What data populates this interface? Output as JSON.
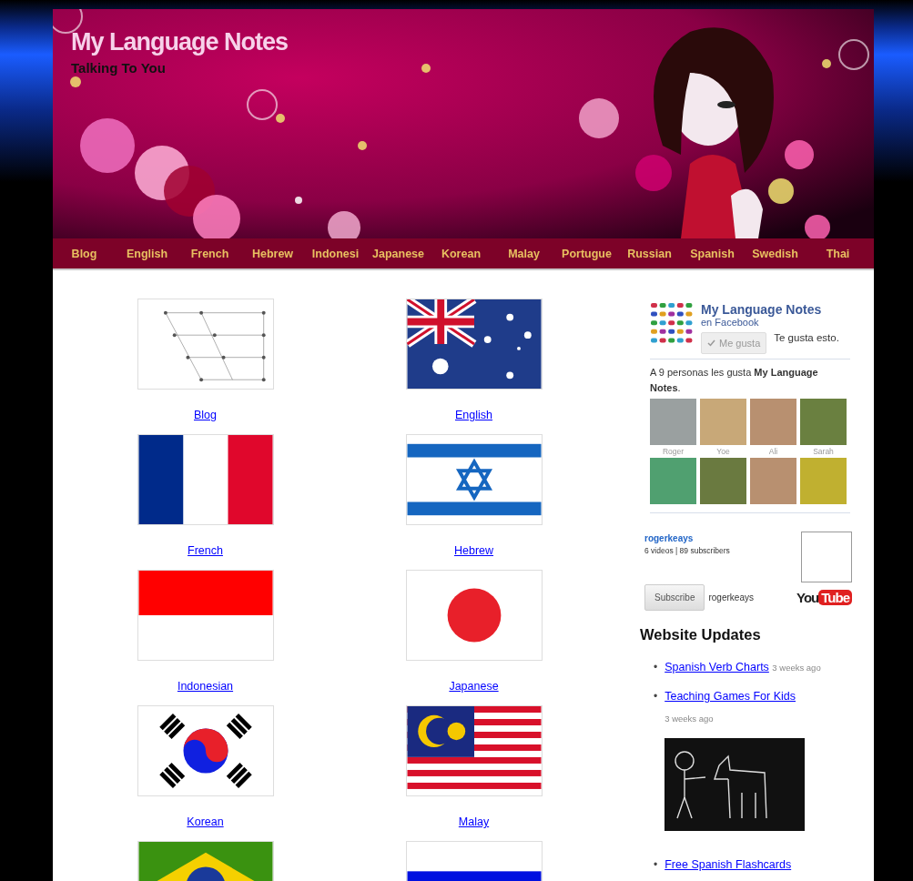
{
  "site": {
    "title": "My Language Notes",
    "tagline": "Talking To You"
  },
  "nav": [
    {
      "label": "Blog"
    },
    {
      "label": "English"
    },
    {
      "label": "French"
    },
    {
      "label": "Hebrew"
    },
    {
      "label": "Indonesi"
    },
    {
      "label": "Japanese"
    },
    {
      "label": "Korean"
    },
    {
      "label": "Malay"
    },
    {
      "label": "Portugue"
    },
    {
      "label": "Russian"
    },
    {
      "label": "Spanish"
    },
    {
      "label": "Swedish"
    },
    {
      "label": "Thai"
    }
  ],
  "languages": [
    {
      "kind": "vowel-chart",
      "label": "Blog"
    },
    {
      "kind": "australia",
      "label": "English"
    },
    {
      "kind": "france",
      "label": "French"
    },
    {
      "kind": "israel",
      "label": "Hebrew"
    },
    {
      "kind": "indonesia",
      "label": "Indonesian"
    },
    {
      "kind": "japan",
      "label": "Japanese"
    },
    {
      "kind": "korea",
      "label": "Korean"
    },
    {
      "kind": "malaysia",
      "label": "Malay"
    },
    {
      "kind": "brazil"
    },
    {
      "kind": "russia"
    }
  ],
  "facebook": {
    "page_name": "My Language Notes",
    "subtitle": "en Facebook",
    "like_button": {
      "label": "Me gusta",
      "disabled": true
    },
    "liked_text": "Te gusta esto.",
    "count_text": "A 9 personas les gusta **My Language Notes**.",
    "fans": [
      {
        "kind": "named",
        "name": "Roger"
      },
      {
        "kind": "named",
        "name": "Yoe"
      },
      {
        "kind": "named",
        "name": "Ali"
      },
      {
        "kind": "named",
        "name": "Sarah"
      },
      {
        "kind": "photo"
      },
      {
        "kind": "photo"
      },
      {
        "kind": "photo"
      },
      {
        "kind": "photo"
      }
    ]
  },
  "youtube": {
    "channel": "rogerkeays",
    "stats": "6 videos | 89 subscribers",
    "subscribe_button": "Subscribe",
    "subscribe_name": "rogerkeays",
    "logo": [
      "You",
      "Tube"
    ]
  },
  "updates": {
    "title": "Website Updates",
    "items": [
      {
        "kind": "inline",
        "marker": "•",
        "title": "Spanish Verb Charts",
        "time": "3 weeks ago"
      },
      {
        "kind": "with-image",
        "marker": "•",
        "title": "Teaching Games For Kids",
        "time": "3 weeks ago"
      },
      {
        "kind": "inline",
        "marker": "•",
        "title": "Free Spanish Flashcards"
      }
    ]
  }
}
